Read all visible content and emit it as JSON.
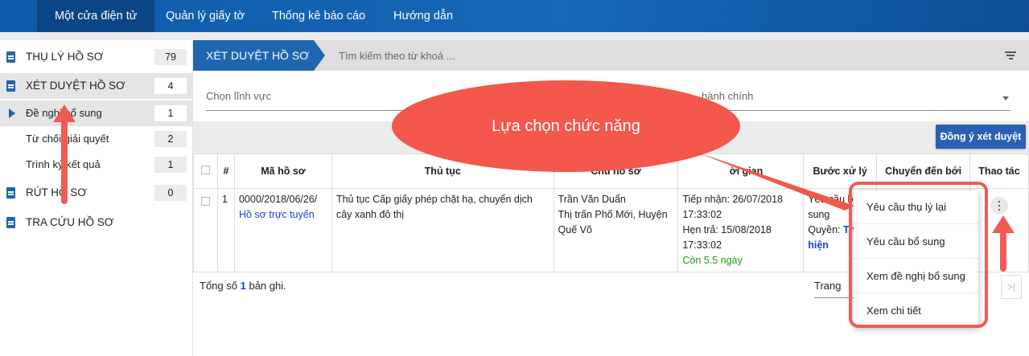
{
  "topnav": [
    "Một cửa điện tử",
    "Quản lý giấy tờ",
    "Thống kê báo cáo",
    "Hướng dẫn"
  ],
  "sidebar": {
    "items": [
      {
        "label": "THỤ LÝ HỒ SƠ",
        "count": "79"
      },
      {
        "label": "XÉT DUYỆT HỒ SƠ",
        "count": "4"
      },
      {
        "label": "Đề nghị bổ sung",
        "count": "1"
      },
      {
        "label": "Từ chối giải quyết",
        "count": "2"
      },
      {
        "label": "Trình ký kết quả",
        "count": "1"
      },
      {
        "label": "RÚT HỒ SƠ",
        "count": "0"
      },
      {
        "label": "TRA CỨU HỒ SƠ"
      }
    ]
  },
  "header": {
    "tab": "XÉT DUYỆT HỒ SƠ",
    "search_placeholder": "Tìm kiếm theo từ khoá ..."
  },
  "filters": {
    "field": "Chọn lĩnh vực",
    "admin": "hành chính"
  },
  "approve_button": "Đồng ý xét duyệt",
  "table": {
    "headers": [
      "#",
      "Mã hồ sơ",
      "Thủ tục",
      "Chủ hồ sơ",
      "ời gian",
      "Bước xử lý",
      "Chuyển đến bởi",
      "Thao tác"
    ],
    "row": {
      "num": "1",
      "code": "0000/2018/06/26/",
      "code_type": "Hồ sơ trực tuyến",
      "procedure": "Thủ tục Cấp giấy phép chặt hạ, chuyển dịch cây xanh đô thị",
      "owner": "Trần Văn Duẩn",
      "address": "Thị trấn Phố Mới, Huyện Quế Võ",
      "received": "Tiếp nhận: 26/07/2018",
      "received_time": "17:33:02",
      "due": "Hẹn trả: 15/08/2018",
      "due_time": "17:33:02",
      "remaining": "Còn 5.5 ngày",
      "step": "Yêu cầu b",
      "step2": "sung",
      "right_label": "Quyền:",
      "right_val": "Th",
      "right_val2": "hiện"
    }
  },
  "footer": {
    "total_prefix": "Tổng số",
    "total": "1",
    "total_suffix": "bản ghi.",
    "page": "Trang"
  },
  "action_menu": [
    "Yêu cầu thụ lý lại",
    "Yêu cầu bổ sung",
    "Xem đề nghị bổ sung",
    "Xem chi tiết"
  ],
  "callout": "Lựa chọn chức năng",
  "colors": {
    "brand": "#1f66b0",
    "callout": "#f4574c",
    "remaining": "#1e9b1e"
  }
}
